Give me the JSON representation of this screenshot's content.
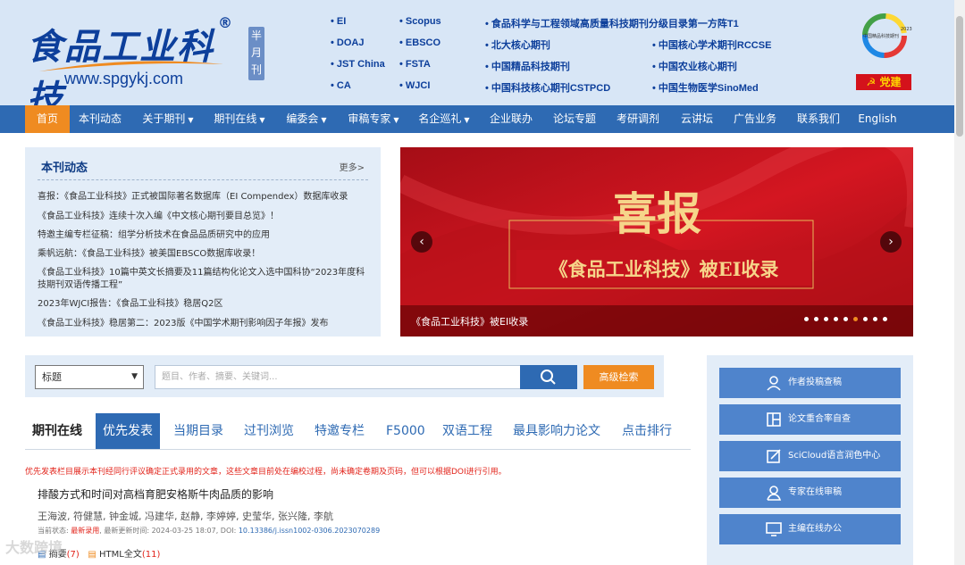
{
  "header": {
    "logo_text": "食品工业科技",
    "logo_reg": "®",
    "logo_url": "www.spgykj.com",
    "frequency": "半月刊",
    "indexes_col1": [
      "EI",
      "DOAJ",
      "JST China",
      "CA"
    ],
    "indexes_col2": [
      "Scopus",
      "EBSCO",
      "FSTA",
      "WJCI"
    ],
    "indexes_col3": [
      "食品科学与工程领域高质量科技期刊分级目录第一方阵T1",
      "北大核心期刊",
      "中国精品科技期刊",
      "中国科技核心期刊CSTPCD"
    ],
    "indexes_col4": [
      "中国核心学术期刊RCCSE",
      "中国农业核心期刊",
      "中国生物医学SinoMed"
    ],
    "award_text": "中国精品科技期刊",
    "award_year": "2023",
    "party_label": "党建"
  },
  "nav": [
    {
      "label": "首页",
      "caret": false
    },
    {
      "label": "本刊动态",
      "caret": false
    },
    {
      "label": "关于期刊",
      "caret": true
    },
    {
      "label": "期刊在线",
      "caret": true
    },
    {
      "label": "编委会",
      "caret": true
    },
    {
      "label": "审稿专家",
      "caret": true
    },
    {
      "label": "名企巡礼",
      "caret": true
    },
    {
      "label": "企业联办",
      "caret": false
    },
    {
      "label": "论坛专题",
      "caret": false
    },
    {
      "label": "考研调剂",
      "caret": false
    },
    {
      "label": "云讲坛",
      "caret": false
    },
    {
      "label": "广告业务",
      "caret": false
    },
    {
      "label": "联系我们",
      "caret": false
    },
    {
      "label": "English",
      "caret": false
    }
  ],
  "news": {
    "title": "本刊动态",
    "more": "更多>",
    "items": [
      "喜报：《食品工业科技》正式被国际著名数据库（EI Compendex）数据库收录",
      "《食品工业科技》连续十次入编《中文核心期刊要目总览》！",
      "特邀主编专栏征稿：组学分析技术在食品品质研究中的应用",
      "乘帆远航：《食品工业科技》被美国EBSCO数据库收录！",
      "《食品工业科技》10篇中英文长摘要及11篇结构化论文入选中国科协“2023年度科技期刊双语传播工程”",
      "2023年WJCI报告：《食品工业科技》稳居Q2区",
      "《食品工业科技》稳居第二：2023版《中国学术期刊影响因子年报》发布"
    ]
  },
  "banner": {
    "headline": "喜报",
    "subline": "《食品工业科技》被EI收录",
    "caption": "《食品工业科技》被EI收录",
    "prev": "‹",
    "next": "›",
    "slide_count": 9,
    "active_slide": 5
  },
  "search": {
    "field": "标题",
    "placeholder": "题目、作者、摘要、关键词...",
    "advanced": "高级检索"
  },
  "tabs": [
    "期刊在线",
    "优先发表",
    "当期目录",
    "过刊浏览",
    "特邀专栏",
    "F5000",
    "双语工程",
    "最具影响力论文",
    "点击排行"
  ],
  "article_list": {
    "notice": "优先发表栏目展示本刊经同行评议确定正式录用的文章，这些文章目前处在编校过程，尚未确定卷期及页码，但可以根据DOI进行引用。",
    "articles": [
      {
        "title": "排酸方式和时间对高档育肥安格斯牛肉品质的影响",
        "authors": "王海波, 符健慧, 钟金城, 冯建华, 赵静, 李婷婷, 史莹华, 张兴隆, 李航",
        "status_label": "当前状态:",
        "status": "最新录用",
        "updated_label": "最新更新时间:",
        "updated": "2024-03-25 18:07",
        "doi_label": "DOI:",
        "doi": "10.13386/j.issn1002-0306.2023070289",
        "abstract_label": "摘要",
        "abstract_count": "(7)",
        "html_label": "HTML全文",
        "html_count": "(11)"
      }
    ]
  },
  "sidebar": [
    {
      "label": "作者投稿查稿",
      "icon": "user-icon"
    },
    {
      "label": "论文重合率自查",
      "icon": "layout-icon"
    },
    {
      "label": "SciCloud语言润色中心",
      "icon": "edit-icon"
    },
    {
      "label": "专家在线审稿",
      "icon": "reviewer-icon"
    },
    {
      "label": "主编在线办公",
      "icon": "monitor-icon"
    }
  ],
  "watermark": "大数跨境",
  "colors": {
    "primary": "#2e6ab3",
    "accent": "#ef8b21",
    "header_bg": "#d8e6f6",
    "panel_bg": "#e3edf8",
    "alert": "#e2231a"
  }
}
